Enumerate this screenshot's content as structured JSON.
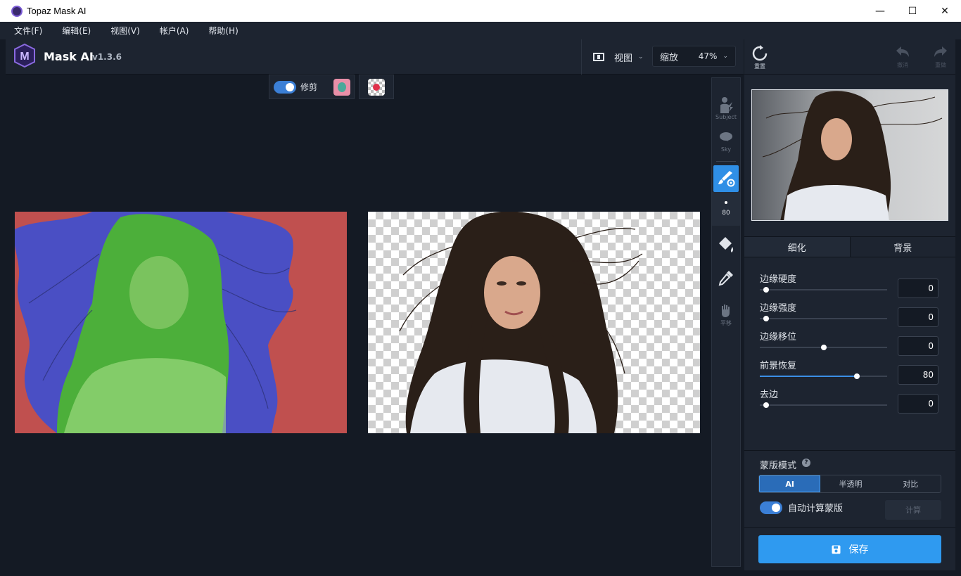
{
  "window": {
    "title": "Topaz Mask AI",
    "minimize": "—",
    "maximize": "☐",
    "close": "✕"
  },
  "menu": [
    "文件(F)",
    "编辑(E)",
    "视图(V)",
    "帐户(A)",
    "帮助(H)"
  ],
  "header": {
    "app_name": "Mask AI",
    "version": "v1.3.6",
    "view_label": "视图",
    "zoom_label": "缩放",
    "zoom_value": "47%"
  },
  "canvas_toolbar": {
    "trim_label": "修剪",
    "trim_on": true
  },
  "tools": {
    "subject": "Subject",
    "sky": "Sky",
    "brush_size": "80",
    "pan": "平移"
  },
  "history": {
    "reset": "重置",
    "undo": "撤消",
    "redo": "重做"
  },
  "tabs": [
    "细化",
    "背景"
  ],
  "sliders": [
    {
      "name": "边缘硬度",
      "value": "0",
      "fraction": 0.05
    },
    {
      "name": "边缘强度",
      "value": "0",
      "fraction": 0.05
    },
    {
      "name": "边缘移位",
      "value": "0",
      "fraction": 0.5
    },
    {
      "name": "前景恢复",
      "value": "80",
      "fraction": 0.76
    },
    {
      "name": "去边",
      "value": "0",
      "fraction": 0.05
    }
  ],
  "mask_mode": {
    "title": "蒙版模式",
    "help": "?",
    "options": [
      "AI",
      "半透明",
      "对比"
    ],
    "selected": "AI",
    "auto_label": "自动计算蒙版",
    "auto_on": true,
    "calc_label": "计算"
  },
  "save_label": "保存",
  "colors": {
    "accent": "#2f9af0",
    "panel": "#1d2430",
    "canvas": "#141a24",
    "mask_keep": "#4caf3a",
    "mask_unknown": "#4a4fc4",
    "mask_remove": "#c0504f"
  }
}
